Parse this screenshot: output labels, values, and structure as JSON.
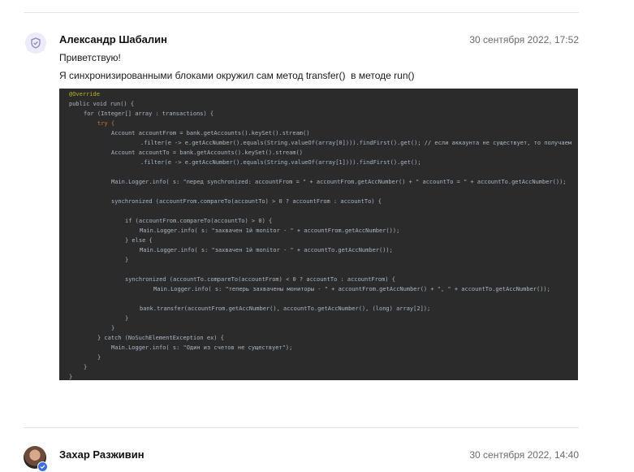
{
  "comments": [
    {
      "author": "Александр Шабалин",
      "date": "30 сентября 2022, 17:52",
      "greeting": "Приветствую!",
      "message": "Я синхронизированными блоками окружил сам метод transfer()  в методе run()",
      "code": {
        "l1": "@Override",
        "l2": "public void run() {",
        "l3": "for (Integer[] array : transactions) {",
        "l4": "try {",
        "l5": "Account accountFrom = bank.getAccounts().keySet().stream()",
        "l6": ".filter(e -> e.getAccNumber().equals(String.valueOf(array[0]))).findFirst().get(); // если аккаунта не существует, то получаем",
        "l7": "Account accountTo = bank.getAccounts().keySet().stream()",
        "l8": ".filter(e -> e.getAccNumber().equals(String.valueOf(array[1]))).findFirst().get();",
        "l9": "Main.Logger.info( s: \"перед synchronized: accountFrom = \" + accountFrom.getAccNumber() + \" accountTo = \" + accountTo.getAccNumber());",
        "l10": "synchronized (accountFrom.compareTo(accountTo) > 0 ? accountFrom : accountTo) {",
        "l11": "if (accountFrom.compareTo(accountTo) > 0) {",
        "l12": "Main.Logger.info( s: \"захвачен 1й monitor - \" + accountFrom.getAccNumber());",
        "l13": "} else {",
        "l14": "Main.Logger.info( s: \"захвачен 1й monitor - \" + accountTo.getAccNumber());",
        "l15": "}",
        "l16": "synchronized (accountTo.compareTo(accountFrom) < 0 ? accountTo : accountFrom) {",
        "l17": "Main.Logger.info( s: \"теперь захвачены мониторы - \" + accountFrom.getAccNumber() + \", \" + accountTo.getAccNumber());",
        "l18": "bank.transfer(accountFrom.getAccNumber(), accountTo.getAccNumber(), (long) array[2]);",
        "l19": "}",
        "l20": "}",
        "l21": "} catch (NoSuchElementException ex) {",
        "l22": "Main.Logger.info( s: \"Один из счетов не существует\");",
        "l23": "}",
        "l24": "}",
        "l25": "}"
      }
    },
    {
      "author": "Захар Разживин",
      "date": "30 сентября 2022, 14:40"
    }
  ]
}
